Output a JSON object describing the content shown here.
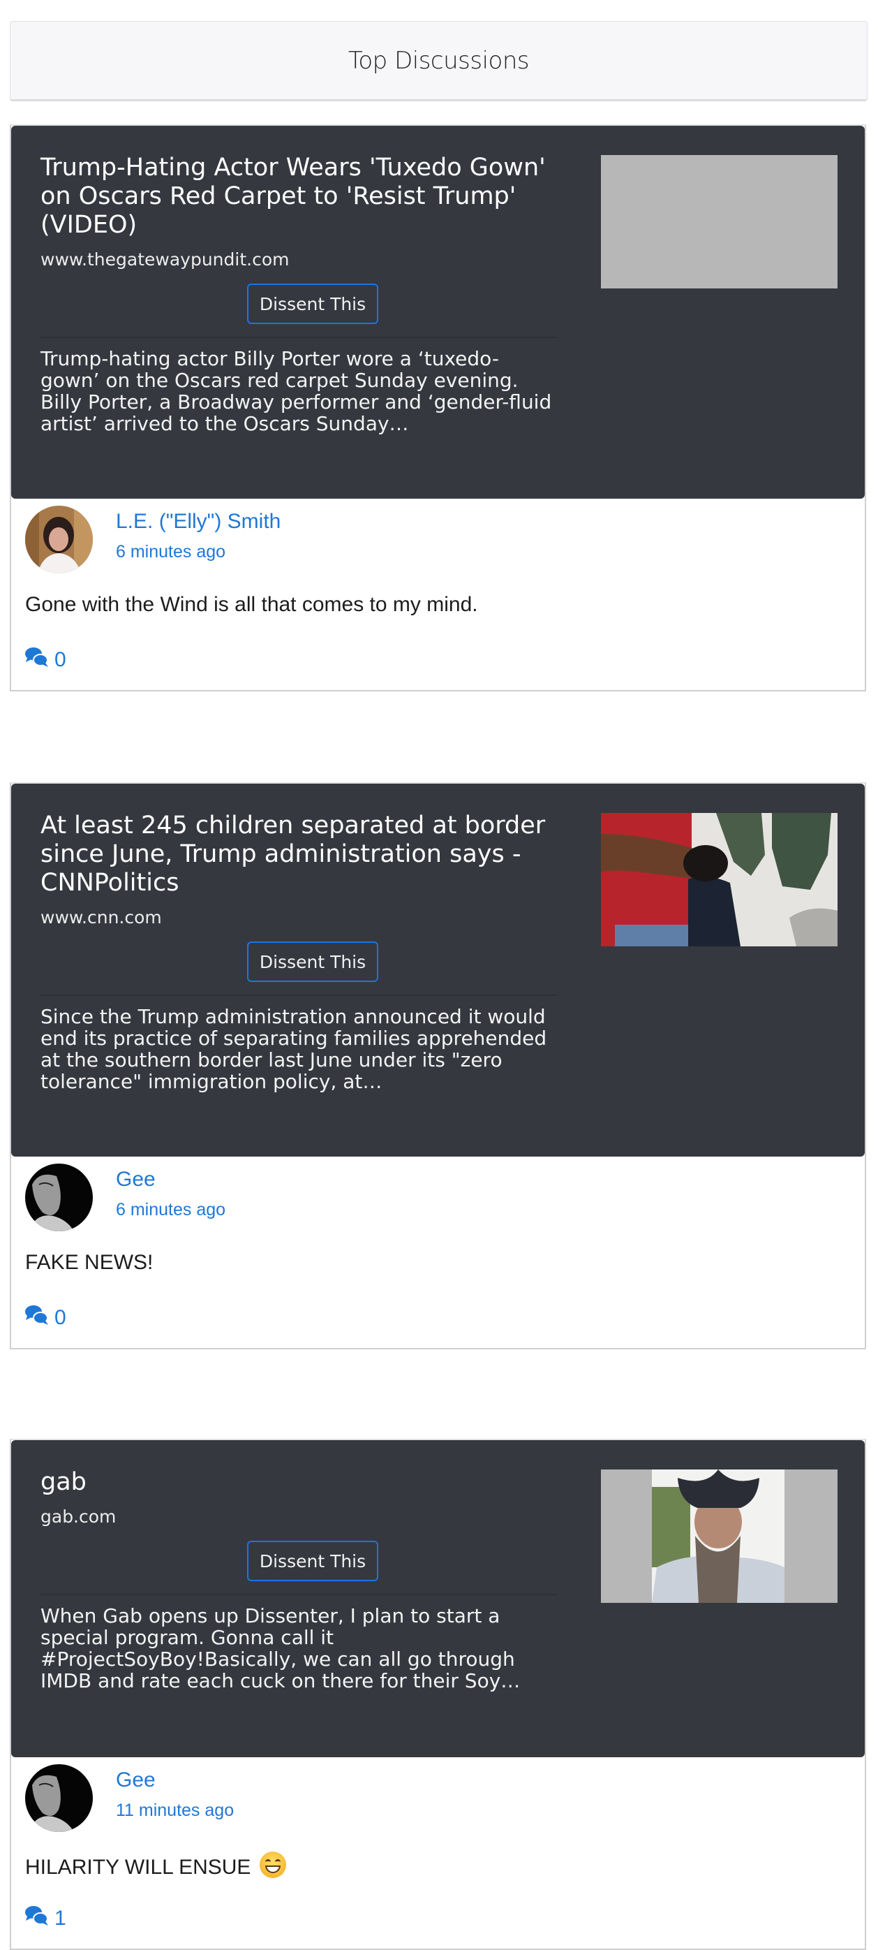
{
  "header": {
    "title": "Top Discussions"
  },
  "colors": {
    "accent": "#1e78d6",
    "button_border": "#1b74e4",
    "card_dark": "#363840",
    "header_bg": "#f7f7f9"
  },
  "discussions": [
    {
      "title": "Trump-Hating Actor Wears 'Tuxedo Gown' on Oscars Red Carpet to 'Resist Trump' (VIDEO)",
      "domain": "www.thegatewaypundit.com",
      "button_label": "Dissent This",
      "description": "Trump-hating actor Billy Porter wore a ‘tuxedo-gown’ on the Oscars red carpet Sunday evening. Billy Porter, a Broadway performer and ‘gender-fluid artist’ arrived to the Oscars Sunday…",
      "thumbnail": "placeholder-gray",
      "comment": {
        "author": "L.E. (\"Elly\") Smith",
        "time": "6 minutes ago",
        "body": "Gone with the Wind is all that comes to my mind.",
        "reply_count": "0"
      }
    },
    {
      "title": "At least 245 children separated at border since June, Trump administration says - CNNPolitics",
      "domain": "www.cnn.com",
      "button_label": "Dissent This",
      "description": "Since the Trump administration announced it would end its practice of separating families apprehended at the southern border last June under its \"zero tolerance\" immigration policy, at…",
      "thumbnail": "photo-border-children",
      "comment": {
        "author": "Gee",
        "time": "6 minutes ago",
        "body": "FAKE NEWS!",
        "reply_count": "0"
      }
    },
    {
      "title": "gab",
      "domain": "gab.com",
      "button_label": "Dissent This",
      "description": "When Gab opens up Dissenter, I plan to start a special program.  Gonna call it #ProjectSoyBoy!Basically, we can all go through IMDB and rate each cuck on there for their Soy…",
      "thumbnail": "photo-bearded-man-cowboy-hat",
      "comment": {
        "author": "Gee",
        "time": "11 minutes ago",
        "body": "HILARITY WILL ENSUE",
        "emoji": "grinning-face",
        "reply_count": "1"
      }
    }
  ]
}
